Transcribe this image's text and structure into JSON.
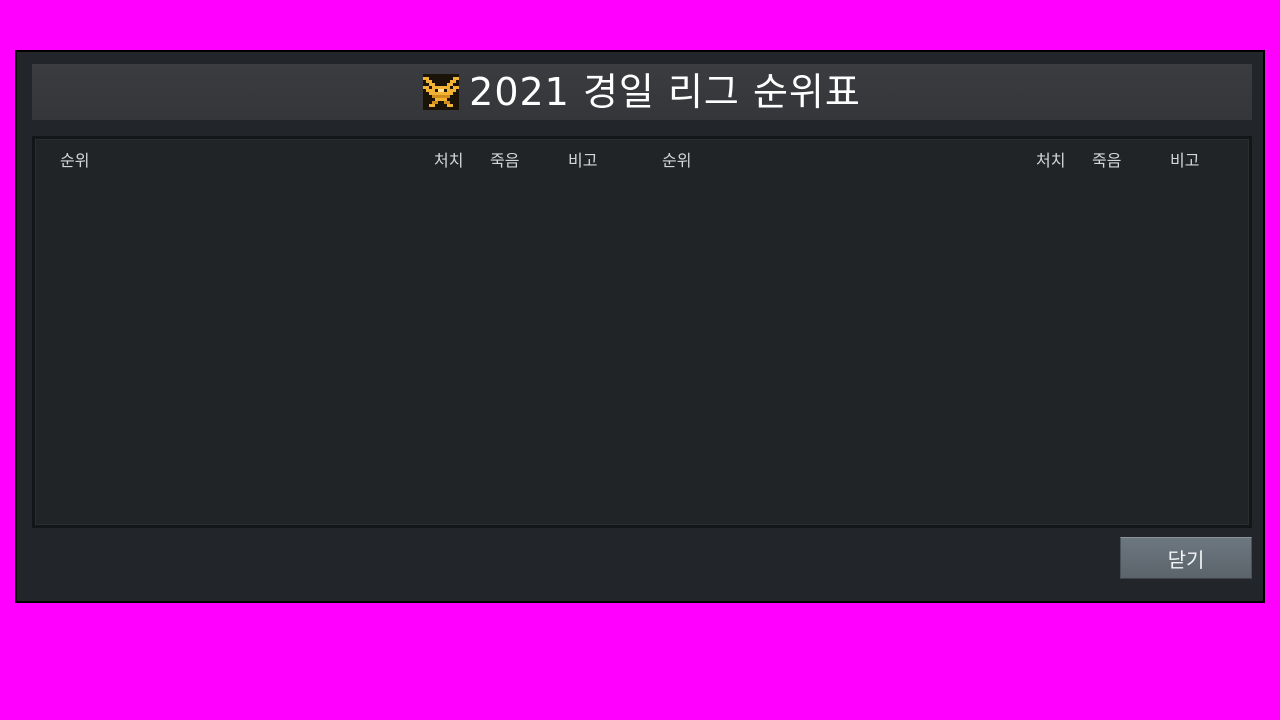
{
  "window": {
    "title": "2021 경일 리그 순위표",
    "title_icon": "gold-rank-emblem-icon"
  },
  "table": {
    "left_columns": [
      "순위",
      "처치",
      "죽음",
      "비고"
    ],
    "right_columns": [
      "순위",
      "처치",
      "죽음",
      "비고"
    ],
    "rows": []
  },
  "footer": {
    "close_label": "닫기"
  },
  "colors": {
    "backdrop": "#ff00ff",
    "window_bg": "#22262a",
    "emblem_gold": "#f2b233",
    "button_bg": "#5f6970"
  }
}
